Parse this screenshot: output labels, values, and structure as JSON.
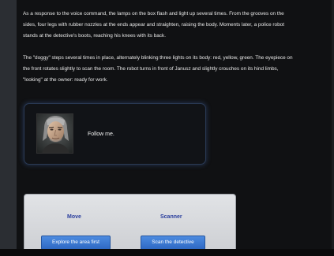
{
  "story": {
    "paragraph1": [
      "As a response to the voice command, the lamps on the box flash and light up several times. From the grooves on the",
      "sides, four legs with rubber nozzles at the ends appear and straighten, raising the body. Moments later, a police robot",
      "stands at the detective's boots, reaching his knees with its back."
    ],
    "paragraph2": [
      "The \"doggy\" steps several times in place, alternately blinking three lights on its body: red, yellow, green. The eyepiece on",
      "the front rotates slightly to scan the room. The robot turns in front of Janusz and slightly crouches on its hind limbs,",
      "\"looking\" at the owner: ready for work."
    ]
  },
  "dialog": {
    "line": "Follow me."
  },
  "choices": {
    "groups": [
      {
        "label": "Move",
        "button": "Explore the area first"
      },
      {
        "label": "Scanner",
        "button": "Scan the detective"
      }
    ]
  },
  "colors": {
    "background": "#101113",
    "text": "#e9e9e9",
    "choice_label": "#2b3f9e",
    "button": "#3a78d4",
    "dialog_glow": "#37558c"
  }
}
